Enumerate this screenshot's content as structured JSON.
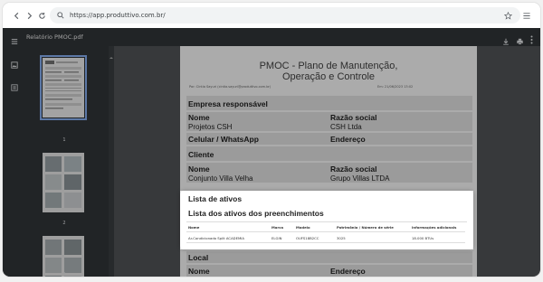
{
  "browser": {
    "url": "https://app.produttivo.com.br/"
  },
  "viewer": {
    "document_title": "Relatório PMOC.pdf",
    "thumbnails": [
      {
        "page": "1"
      },
      {
        "page": "2"
      },
      {
        "page": "3"
      }
    ]
  },
  "pdf": {
    "title_line1": "PMOC - Plano de Manutenção,",
    "title_line2": "Operação e Controle",
    "meta_left": "Por: Cintia Sayuri (cintia.sayuri@produttivo.com.br)",
    "meta_right": "Em: 21/06/2023 13:02",
    "empresa_header": "Empresa responsável",
    "nome_label": "Nome",
    "nome_value": "Projetos CSH",
    "razao_label": "Razão social",
    "razao_value": "CSH Ltda",
    "celular_label": "Celular / WhatsApp",
    "endereco_label": "Endereço",
    "cliente_header": "Cliente",
    "cliente_nome_label": "Nome",
    "cliente_nome_value": "Conjunto Villa Velha",
    "cliente_razao_label": "Razão social",
    "cliente_razao_value": "Grupo Villas LTDA",
    "ativos_header": "Lista de ativos",
    "preenchimentos_header": "Lista dos ativos dos preenchimentos",
    "table": {
      "headers": [
        "Nome",
        "Marca",
        "Modelo",
        "Patrimônio / Número de série",
        "Informações adicionais"
      ],
      "row": [
        "Ar-Condicionado Split ACADEMIA",
        "ELGIN",
        "OUFS18B2CC",
        "3025",
        "18.000 BTUs"
      ]
    },
    "local_header": "Local",
    "local_nome_label": "Nome",
    "local_endereco_label": "Endereço"
  }
}
